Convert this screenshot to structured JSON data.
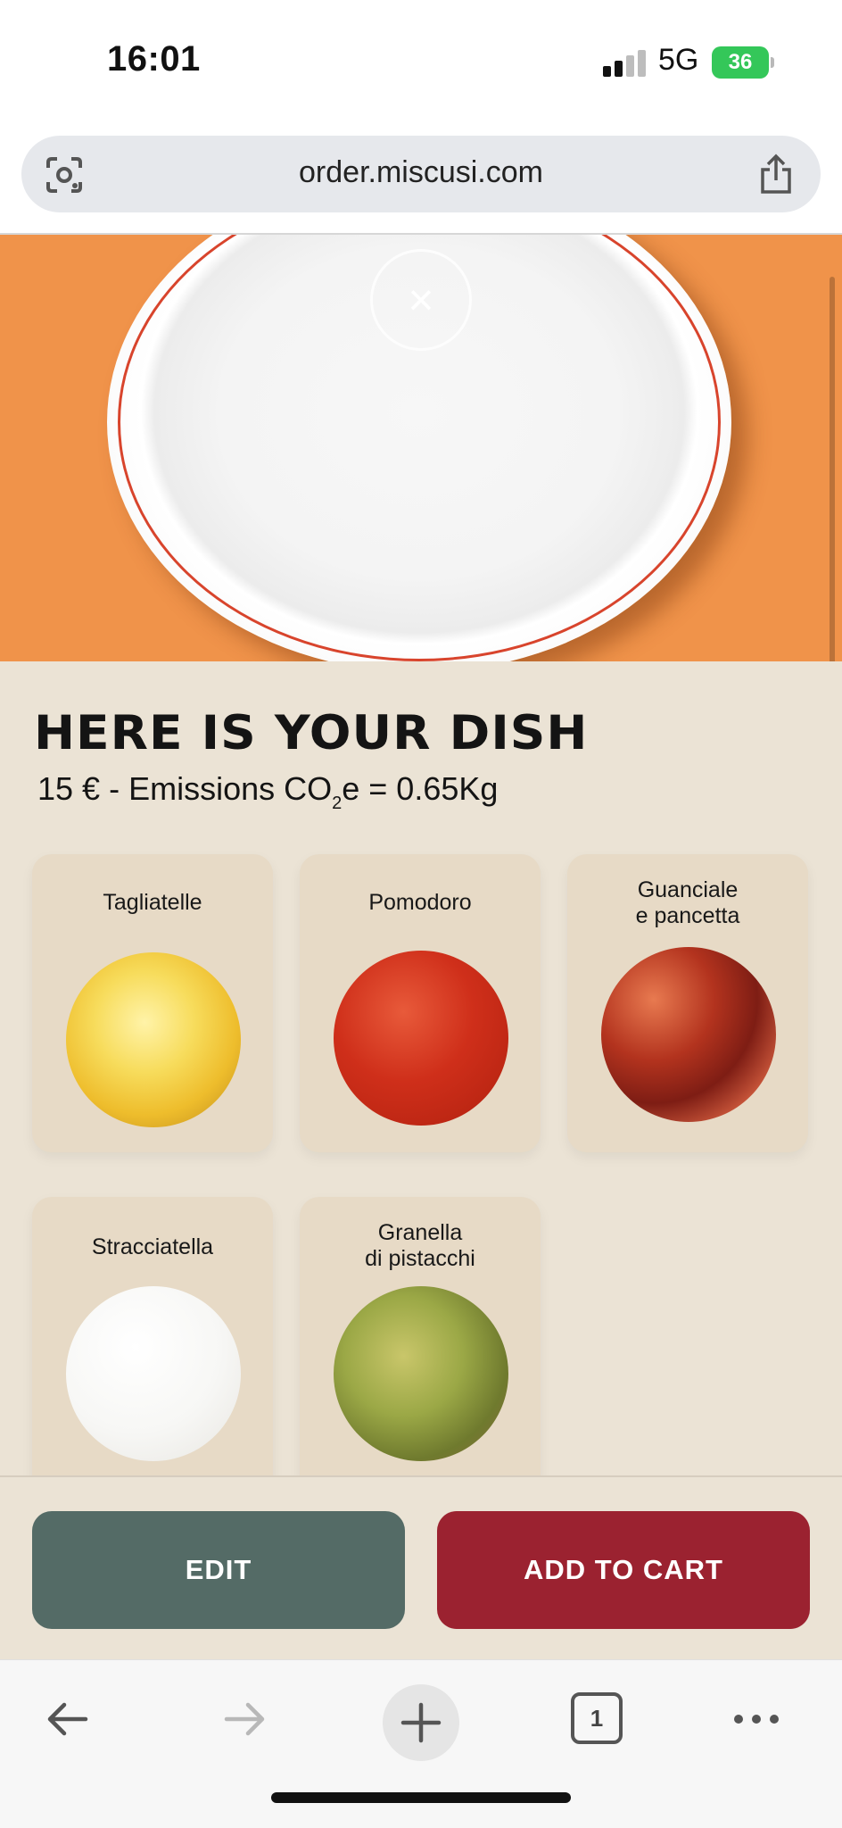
{
  "status_bar": {
    "time": "16:01",
    "network": "5G",
    "battery": "36"
  },
  "browser": {
    "url": "order.miscusi.com",
    "tab_count": "1"
  },
  "hero": {
    "close_icon": "×"
  },
  "dish": {
    "title": "HERE IS YOUR DISH",
    "price": "15 €",
    "emissions_prefix": "- Emissions CO",
    "emissions_sub": "2",
    "emissions_suffix": "e = 0.65Kg"
  },
  "ingredients": [
    {
      "label_line1": "Tagliatelle",
      "label_line2": ""
    },
    {
      "label_line1": "Pomodoro",
      "label_line2": ""
    },
    {
      "label_line1": "Guanciale",
      "label_line2": "e pancetta"
    },
    {
      "label_line1": "Stracciatella",
      "label_line2": ""
    },
    {
      "label_line1": "Granella",
      "label_line2": "di pistacchi"
    }
  ],
  "actions": {
    "edit": "EDIT",
    "add_to_cart": "ADD TO CART"
  },
  "colors": {
    "hero_bg": "#f0934a",
    "content_bg": "#ebe3d5",
    "edit_btn": "#546b66",
    "cart_btn": "#9b2230",
    "battery": "#34c759"
  }
}
